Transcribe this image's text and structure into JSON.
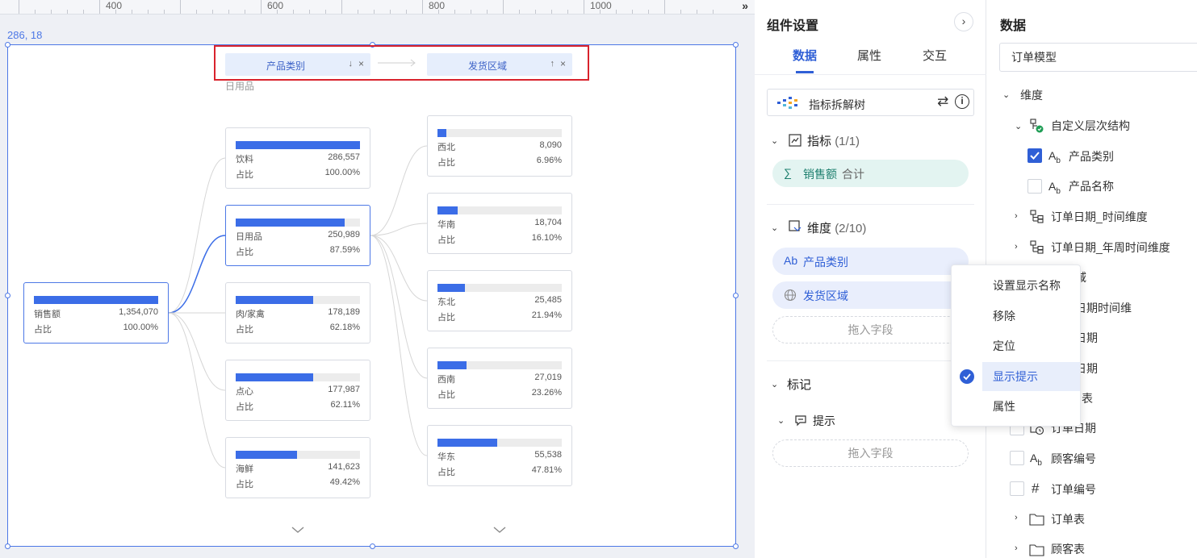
{
  "ruler": {
    "marks": [
      "400",
      "600",
      "800",
      "1000"
    ],
    "expand_icon": "double-chevron-right"
  },
  "canvas": {
    "coords": "286, 18",
    "drill_path": [
      {
        "label": "产品类别",
        "sort_icon": "↓",
        "close": "×"
      },
      {
        "label": "发货区域",
        "sort_icon": "↑",
        "close": "×"
      }
    ],
    "path_sub": "日用品",
    "root": {
      "name": "销售额",
      "value": "1,354,070",
      "ratio_label": "占比",
      "pct": "100.00%",
      "fill": 1.0
    },
    "level1": [
      {
        "name": "饮料",
        "value": "286,557",
        "ratio_label": "占比",
        "pct": "100.00%",
        "fill": 1.0
      },
      {
        "name": "日用品",
        "value": "250,989",
        "ratio_label": "占比",
        "pct": "87.59%",
        "fill": 0.8759
      },
      {
        "name": "肉/家禽",
        "value": "178,189",
        "ratio_label": "占比",
        "pct": "62.18%",
        "fill": 0.6218
      },
      {
        "name": "点心",
        "value": "177,987",
        "ratio_label": "占比",
        "pct": "62.11%",
        "fill": 0.6211
      },
      {
        "name": "海鲜",
        "value": "141,623",
        "ratio_label": "占比",
        "pct": "49.42%",
        "fill": 0.4942
      }
    ],
    "level2": [
      {
        "name": "西北",
        "value": "8,090",
        "ratio_label": "占比",
        "pct": "6.96%",
        "fill": 0.0696
      },
      {
        "name": "华南",
        "value": "18,704",
        "ratio_label": "占比",
        "pct": "16.10%",
        "fill": 0.161
      },
      {
        "name": "东北",
        "value": "25,485",
        "ratio_label": "占比",
        "pct": "21.94%",
        "fill": 0.2194
      },
      {
        "name": "西南",
        "value": "27,019",
        "ratio_label": "占比",
        "pct": "23.26%",
        "fill": 0.2326
      },
      {
        "name": "华东",
        "value": "55,538",
        "ratio_label": "占比",
        "pct": "47.81%",
        "fill": 0.4781
      }
    ]
  },
  "settings": {
    "title": "组件设置",
    "collapse_icon": "›",
    "tabs": [
      "数据",
      "属性",
      "交互"
    ],
    "active_tab": 0,
    "chart_type": "指标拆解树",
    "swap_icon": "⇄",
    "info_icon": "i",
    "measures": {
      "title": "指标",
      "count": "(1/1)",
      "items": [
        {
          "icon": "∑",
          "label": "销售额",
          "agg": "合计"
        }
      ]
    },
    "dimensions": {
      "title": "维度",
      "count": "(2/10)",
      "items": [
        {
          "icon": "Ab",
          "label": "产品类别"
        },
        {
          "icon": "globe-icon",
          "label": "发货区域"
        }
      ],
      "drop": "拖入字段"
    },
    "marks": {
      "title": "标记",
      "tooltip": {
        "title": "提示",
        "drop": "拖入字段"
      }
    }
  },
  "context_menu": {
    "items": [
      "设置显示名称",
      "移除",
      "定位",
      "显示提示",
      "属性"
    ],
    "active_index": 3
  },
  "data_panel": {
    "title": "数据",
    "model": "订单模型",
    "tree": [
      {
        "label": "维度"
      },
      {
        "label": "自定义层次结构"
      },
      {
        "label": "产品类别",
        "checked": true
      },
      {
        "label": "产品名称",
        "checked": false
      },
      {
        "label": "订单日期_时间维度"
      },
      {
        "label": "订单日期_年周时间维度"
      },
      {
        "label": "区域"
      },
      {
        "label": "日期时间维"
      },
      {
        "label": "日期"
      },
      {
        "label": "日期"
      },
      {
        "label": "表"
      },
      {
        "label": "订单日期"
      },
      {
        "label": "顾客编号"
      },
      {
        "label": "订单编号"
      },
      {
        "label": "订单表"
      },
      {
        "label": "顾客表"
      }
    ]
  },
  "colors": {
    "accent": "#2f5fd6",
    "bar": "#3b6de7",
    "highlight_border": "#d9232d",
    "selection": "#4d78e6"
  }
}
